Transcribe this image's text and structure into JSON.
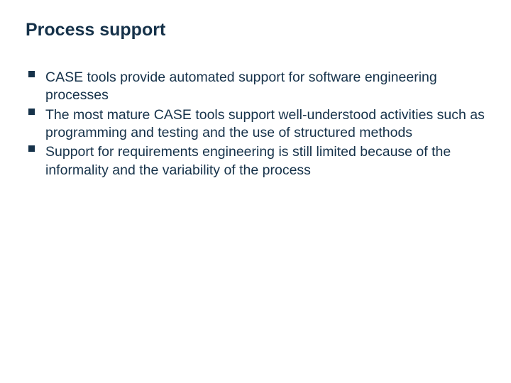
{
  "title": "Process support",
  "bullets": [
    "CASE tools provide automated support for software engineering processes",
    "The most mature CASE tools support well-understood activities such as programming and testing and the use of structured methods",
    "Support for requirements engineering is still limited because of the informality and the variability of the process"
  ]
}
